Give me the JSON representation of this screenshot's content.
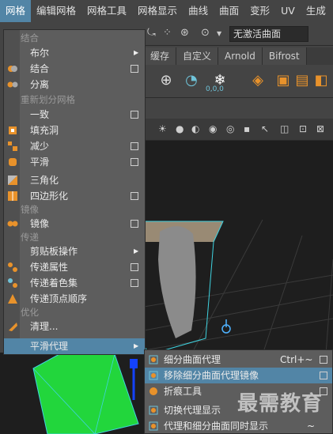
{
  "menubar": {
    "items": [
      "网格",
      "编辑网格",
      "网格工具",
      "网格显示",
      "曲线",
      "曲面",
      "变形",
      "UV",
      "生成"
    ]
  },
  "toolbar": {
    "no_active_surface": "无激活曲面"
  },
  "shelf_tabs": [
    "缓存",
    "自定义",
    "Arnold",
    "Bifrost"
  ],
  "shelf_icon_label": "0,0,0",
  "mesh_menu": {
    "sections": {
      "combine": "结合",
      "remesh": "重新划分网格",
      "mirror": "镜像",
      "transfer": "传递",
      "optimize": "优化"
    },
    "items": {
      "boolean": "布尔",
      "combine": "结合",
      "separate": "分离",
      "conform": "一致",
      "fill_hole": "填充洞",
      "reduce": "减少",
      "smooth": "平滑",
      "triangulate": "三角化",
      "quadrangulate": "四边形化",
      "mirror": "镜像",
      "clipboard": "剪贴板操作",
      "transfer_attributes": "传递属性",
      "transfer_shading_sets": "传递着色集",
      "transfer_vertex_order": "传递顶点顺序",
      "cleanup": "清理...",
      "smooth_proxy": "平滑代理"
    }
  },
  "submenu": {
    "subdiv_proxy": "细分曲面代理",
    "subdiv_proxy_shortcut": "Ctrl+~",
    "remove_subdiv_mirror": "移除细分曲面代理镜像",
    "crease_tool": "折痕工具",
    "toggle_proxy_display": "切换代理显示",
    "both_proxy_display": "代理和细分曲面同时显示",
    "both_proxy_shortcut": "~"
  },
  "watermark": "最需教育",
  "colors": {
    "menu_bg": "#5d5d5d",
    "highlight": "#5285a6",
    "viewport_bg": "#1e1e1e",
    "green_mesh": "#22d63c",
    "cyan_wire": "#3fd3e0"
  }
}
